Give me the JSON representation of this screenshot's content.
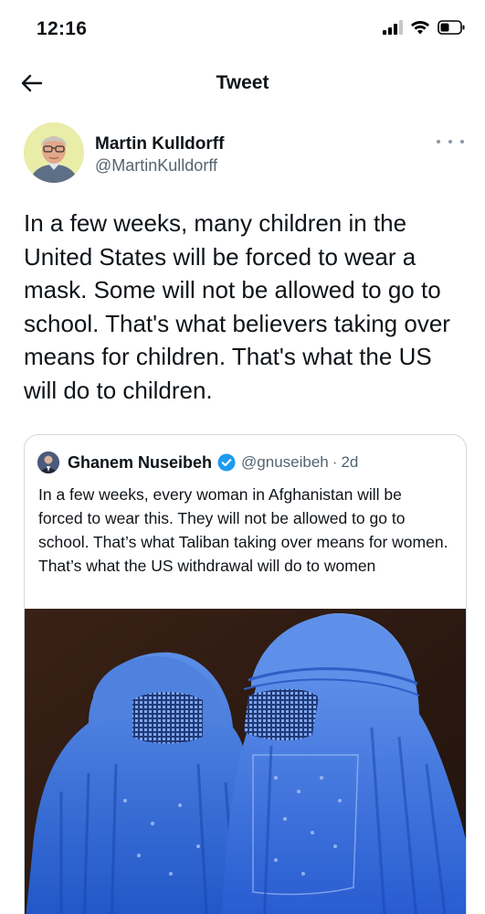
{
  "status_bar": {
    "time": "12:16"
  },
  "nav": {
    "title": "Tweet"
  },
  "tweet": {
    "author_name": "Martin Kulldorff",
    "author_handle": "@MartinKulldorff",
    "text": "In a few weeks, many children in the United States will be forced to wear a mask. Some will not be allowed to go to school. That's what believers taking over means for children. That's what the US will do to children."
  },
  "quoted_tweet": {
    "author_name": "Ghanem Nuseibeh",
    "author_handle": "@gnuseibeh",
    "time_ago": "2d",
    "separator": "·",
    "text": "In a few weeks, every woman in Afghanistan will be forced to wear this. They will not be allowed to go to school. That’s what Taliban taking over means for women. That’s what the US withdrawal will do to women"
  },
  "colors": {
    "text_primary": "#0f1419",
    "text_secondary": "#536471",
    "verified_blue": "#1d9bf0",
    "card_border": "#cfd9de",
    "burqa_blue": "#2f6fd6"
  },
  "icons": [
    "back-arrow-icon",
    "more-options-icon",
    "verified-badge-icon",
    "signal-icon",
    "wifi-icon",
    "battery-icon"
  ]
}
